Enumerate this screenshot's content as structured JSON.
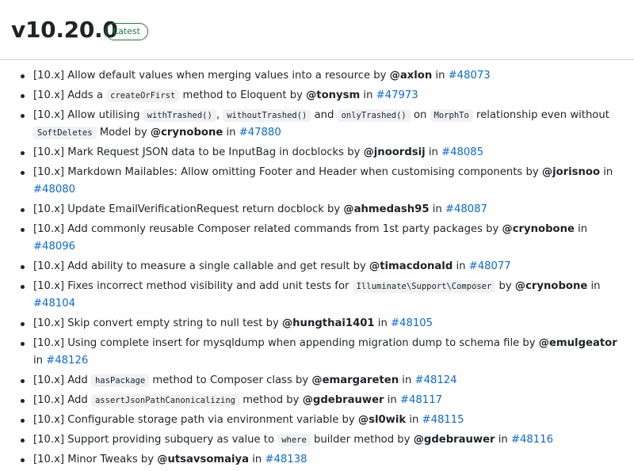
{
  "release": {
    "version": "v10.20.0",
    "badge": "Latest"
  },
  "notes": [
    {
      "parts": [
        {
          "t": "text",
          "v": "[10.x] Allow default values when merging values into a resource by "
        },
        {
          "t": "user",
          "v": "@axlon"
        },
        {
          "t": "text",
          "v": " in "
        },
        {
          "t": "pr",
          "v": "#48073"
        }
      ]
    },
    {
      "parts": [
        {
          "t": "text",
          "v": "[10.x] Adds a "
        },
        {
          "t": "code",
          "v": "createOrFirst"
        },
        {
          "t": "text",
          "v": " method to Eloquent by "
        },
        {
          "t": "user",
          "v": "@tonysm"
        },
        {
          "t": "text",
          "v": " in "
        },
        {
          "t": "pr",
          "v": "#47973"
        }
      ]
    },
    {
      "parts": [
        {
          "t": "text",
          "v": "[10.x] Allow utilising "
        },
        {
          "t": "code",
          "v": "withTrashed()"
        },
        {
          "t": "text",
          "v": ", "
        },
        {
          "t": "code",
          "v": "withoutTrashed()"
        },
        {
          "t": "text",
          "v": " and "
        },
        {
          "t": "code",
          "v": "onlyTrashed()"
        },
        {
          "t": "text",
          "v": " on "
        },
        {
          "t": "code",
          "v": "MorphTo"
        },
        {
          "t": "text",
          "v": " relationship even without "
        },
        {
          "t": "code",
          "v": "SoftDeletes"
        },
        {
          "t": "text",
          "v": " Model by "
        },
        {
          "t": "user",
          "v": "@crynobone"
        },
        {
          "t": "text",
          "v": " in "
        },
        {
          "t": "pr",
          "v": "#47880"
        }
      ]
    },
    {
      "parts": [
        {
          "t": "text",
          "v": "[10.x] Mark Request JSON data to be InputBag in docblocks by "
        },
        {
          "t": "user",
          "v": "@jnoordsij"
        },
        {
          "t": "text",
          "v": " in "
        },
        {
          "t": "pr",
          "v": "#48085"
        }
      ]
    },
    {
      "parts": [
        {
          "t": "text",
          "v": "[10.x] Markdown Mailables: Allow omitting Footer and Header when customising components by "
        },
        {
          "t": "user",
          "v": "@jorisnoo"
        },
        {
          "t": "text",
          "v": " in "
        },
        {
          "t": "pr",
          "v": "#48080"
        }
      ]
    },
    {
      "parts": [
        {
          "t": "text",
          "v": "[10.x] Update EmailVerificationRequest return docblock by "
        },
        {
          "t": "user",
          "v": "@ahmedash95"
        },
        {
          "t": "text",
          "v": " in "
        },
        {
          "t": "pr",
          "v": "#48087"
        }
      ]
    },
    {
      "parts": [
        {
          "t": "text",
          "v": "[10.x] Add commonly reusable Composer related commands from 1st party packages by "
        },
        {
          "t": "user",
          "v": "@crynobone"
        },
        {
          "t": "text",
          "v": " in "
        },
        {
          "t": "pr",
          "v": "#48096"
        }
      ]
    },
    {
      "parts": [
        {
          "t": "text",
          "v": "[10.x] Add ability to measure a single callable and get result by "
        },
        {
          "t": "user",
          "v": "@timacdonald"
        },
        {
          "t": "text",
          "v": " in "
        },
        {
          "t": "pr",
          "v": "#48077"
        }
      ]
    },
    {
      "parts": [
        {
          "t": "text",
          "v": "[10.x] Fixes incorrect method visibility and add unit tests for "
        },
        {
          "t": "code",
          "v": "Illuminate\\Support\\Composer"
        },
        {
          "t": "text",
          "v": " by "
        },
        {
          "t": "user",
          "v": "@crynobone"
        },
        {
          "t": "text",
          "v": " in "
        },
        {
          "t": "pr",
          "v": "#48104"
        }
      ]
    },
    {
      "parts": [
        {
          "t": "text",
          "v": "[10.x] Skip convert empty string to null test by "
        },
        {
          "t": "user",
          "v": "@hungthai1401"
        },
        {
          "t": "text",
          "v": " in "
        },
        {
          "t": "pr",
          "v": "#48105"
        }
      ]
    },
    {
      "parts": [
        {
          "t": "text",
          "v": "[10.x] Using complete insert for mysqldump when appending migration dump to schema file by "
        },
        {
          "t": "user",
          "v": "@emulgeator"
        },
        {
          "t": "text",
          "v": " in "
        },
        {
          "t": "pr",
          "v": "#48126"
        }
      ]
    },
    {
      "parts": [
        {
          "t": "text",
          "v": "[10.x] Add "
        },
        {
          "t": "code",
          "v": "hasPackage"
        },
        {
          "t": "text",
          "v": " method to Composer class by "
        },
        {
          "t": "user",
          "v": "@emargareten"
        },
        {
          "t": "text",
          "v": " in "
        },
        {
          "t": "pr",
          "v": "#48124"
        }
      ]
    },
    {
      "parts": [
        {
          "t": "text",
          "v": "[10.x] Add "
        },
        {
          "t": "code",
          "v": "assertJsonPathCanonicalizing"
        },
        {
          "t": "text",
          "v": " method by "
        },
        {
          "t": "user",
          "v": "@gdebrauwer"
        },
        {
          "t": "text",
          "v": " in "
        },
        {
          "t": "pr",
          "v": "#48117"
        }
      ]
    },
    {
      "parts": [
        {
          "t": "text",
          "v": "[10.x] Configurable storage path via environment variable by "
        },
        {
          "t": "user",
          "v": "@sl0wik"
        },
        {
          "t": "text",
          "v": " in "
        },
        {
          "t": "pr",
          "v": "#48115"
        }
      ]
    },
    {
      "parts": [
        {
          "t": "text",
          "v": "[10.x] Support providing subquery as value to "
        },
        {
          "t": "code",
          "v": "where"
        },
        {
          "t": "text",
          "v": " builder method by "
        },
        {
          "t": "user",
          "v": "@gdebrauwer"
        },
        {
          "t": "text",
          "v": " in "
        },
        {
          "t": "pr",
          "v": "#48116"
        }
      ]
    },
    {
      "parts": [
        {
          "t": "text",
          "v": "[10.x] Minor Tweaks by "
        },
        {
          "t": "user",
          "v": "@utsavsomaiya"
        },
        {
          "t": "text",
          "v": " in "
        },
        {
          "t": "pr",
          "v": "#48138"
        }
      ]
    }
  ]
}
